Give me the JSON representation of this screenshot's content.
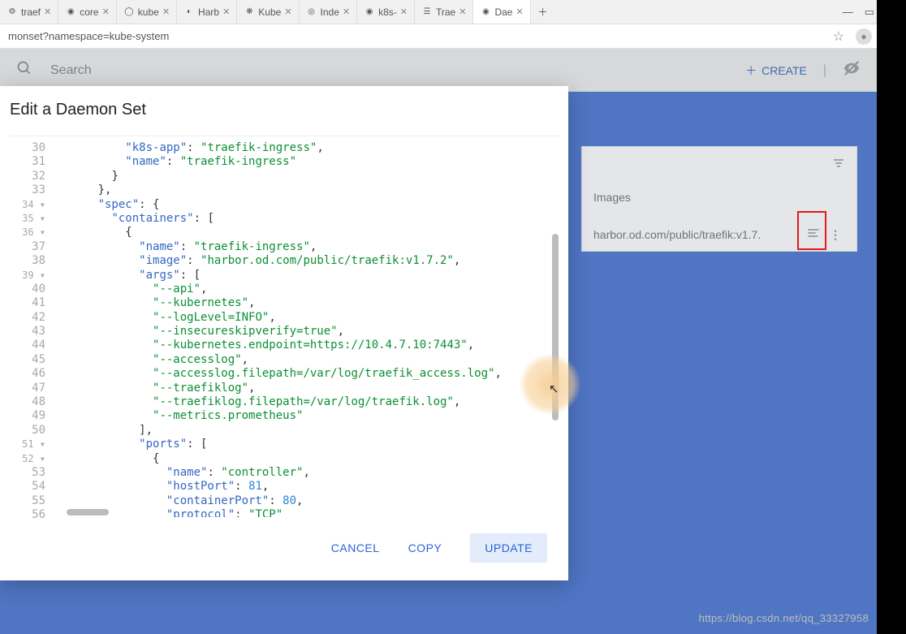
{
  "browser": {
    "tabs": [
      {
        "label": "traef"
      },
      {
        "label": "core"
      },
      {
        "label": "kube"
      },
      {
        "label": "Harb"
      },
      {
        "label": "Kube"
      },
      {
        "label": "Inde"
      },
      {
        "label": "k8s-"
      },
      {
        "label": "Trae"
      },
      {
        "label": "Dae"
      }
    ],
    "url": "monset?namespace=kube-system"
  },
  "header": {
    "searchPlaceholder": "Search",
    "createLabel": "CREATE"
  },
  "panel": {
    "heading": "Images",
    "image": "harbor.od.com/public/traefik:v1.7."
  },
  "dialog": {
    "title": "Edit a Daemon Set",
    "buttons": {
      "cancel": "CANCEL",
      "copy": "COPY",
      "update": "UPDATE"
    }
  },
  "code": {
    "startLine": 30,
    "lines": [
      {
        "t": "kv",
        "indent": 10,
        "key": "k8s-app",
        "val": "\"traefik-ingress\"",
        "tail": ","
      },
      {
        "t": "kv",
        "indent": 10,
        "key": "name",
        "val": "\"traefik-ingress\""
      },
      {
        "t": "punct",
        "indent": 8,
        "text": "}"
      },
      {
        "t": "punct",
        "indent": 6,
        "text": "},"
      },
      {
        "t": "obj",
        "indent": 6,
        "key": "spec",
        "open": "{",
        "fold": true
      },
      {
        "t": "obj",
        "indent": 8,
        "key": "containers",
        "open": "[",
        "fold": true
      },
      {
        "t": "punct",
        "indent": 10,
        "text": "{",
        "fold": true
      },
      {
        "t": "kv",
        "indent": 12,
        "key": "name",
        "val": "\"traefik-ingress\"",
        "tail": ","
      },
      {
        "t": "kv",
        "indent": 12,
        "key": "image",
        "val": "\"harbor.od.com/public/traefik:v1.7.2\"",
        "tail": ","
      },
      {
        "t": "obj",
        "indent": 12,
        "key": "args",
        "open": "[",
        "fold": true
      },
      {
        "t": "str",
        "indent": 14,
        "val": "\"--api\"",
        "tail": ","
      },
      {
        "t": "str",
        "indent": 14,
        "val": "\"--kubernetes\"",
        "tail": ","
      },
      {
        "t": "str",
        "indent": 14,
        "val": "\"--logLevel=INFO\"",
        "tail": ","
      },
      {
        "t": "str",
        "indent": 14,
        "val": "\"--insecureskipverify=true\"",
        "tail": ","
      },
      {
        "t": "str",
        "indent": 14,
        "val": "\"--kubernetes.endpoint=https://10.4.7.10:7443\"",
        "tail": ","
      },
      {
        "t": "str",
        "indent": 14,
        "val": "\"--accesslog\"",
        "tail": ","
      },
      {
        "t": "str",
        "indent": 14,
        "val": "\"--accesslog.filepath=/var/log/traefik_access.log\"",
        "tail": ","
      },
      {
        "t": "str",
        "indent": 14,
        "val": "\"--traefiklog\"",
        "tail": ","
      },
      {
        "t": "str",
        "indent": 14,
        "val": "\"--traefiklog.filepath=/var/log/traefik.log\"",
        "tail": ","
      },
      {
        "t": "str",
        "indent": 14,
        "val": "\"--metrics.prometheus\""
      },
      {
        "t": "punct",
        "indent": 12,
        "text": "],"
      },
      {
        "t": "obj",
        "indent": 12,
        "key": "ports",
        "open": "[",
        "fold": true
      },
      {
        "t": "punct",
        "indent": 14,
        "text": "{",
        "fold": true
      },
      {
        "t": "kv",
        "indent": 16,
        "key": "name",
        "val": "\"controller\"",
        "tail": ","
      },
      {
        "t": "kvnum",
        "indent": 16,
        "key": "hostPort",
        "num": "81",
        "tail": ","
      },
      {
        "t": "kvnum",
        "indent": 16,
        "key": "containerPort",
        "num": "80",
        "tail": ","
      },
      {
        "t": "kv",
        "indent": 16,
        "key": "protocol",
        "val": "\"TCP\""
      }
    ]
  },
  "watermark": "https://blog.csdn.net/qq_33327958"
}
